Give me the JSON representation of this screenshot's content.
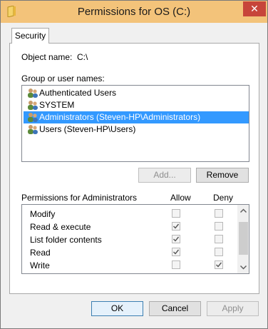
{
  "window": {
    "title": "Permissions for OS (C:)",
    "close_glyph": "✕",
    "title_icon": "folder-icon"
  },
  "tabs": [
    {
      "label": "Security",
      "selected": true
    }
  ],
  "object": {
    "label": "Object name:",
    "value": "C:\\"
  },
  "groups": {
    "label": "Group or user names:",
    "items": [
      {
        "label": "Authenticated Users",
        "icon": "users-icon",
        "selected": false
      },
      {
        "label": "SYSTEM",
        "icon": "users-icon",
        "selected": false
      },
      {
        "label": "Administrators (Steven-HP\\Administrators)",
        "icon": "users-icon",
        "selected": true
      },
      {
        "label": "Users (Steven-HP\\Users)",
        "icon": "users-icon",
        "selected": false
      }
    ],
    "add_label": "Add...",
    "remove_label": "Remove"
  },
  "permissions": {
    "title": "Permissions for Administrators",
    "allow_header": "Allow",
    "deny_header": "Deny",
    "rows": [
      {
        "label": "Modify",
        "allow": false,
        "deny": false
      },
      {
        "label": "Read & execute",
        "allow": true,
        "deny": false
      },
      {
        "label": "List folder contents",
        "allow": true,
        "deny": false
      },
      {
        "label": "Read",
        "allow": true,
        "deny": false
      },
      {
        "label": "Write",
        "allow": false,
        "deny": true
      }
    ]
  },
  "footer": {
    "ok_label": "OK",
    "cancel_label": "Cancel",
    "apply_label": "Apply"
  },
  "colors": {
    "title_bar": "#f3c37a",
    "close": "#c7453a",
    "selection": "#3399ff"
  }
}
